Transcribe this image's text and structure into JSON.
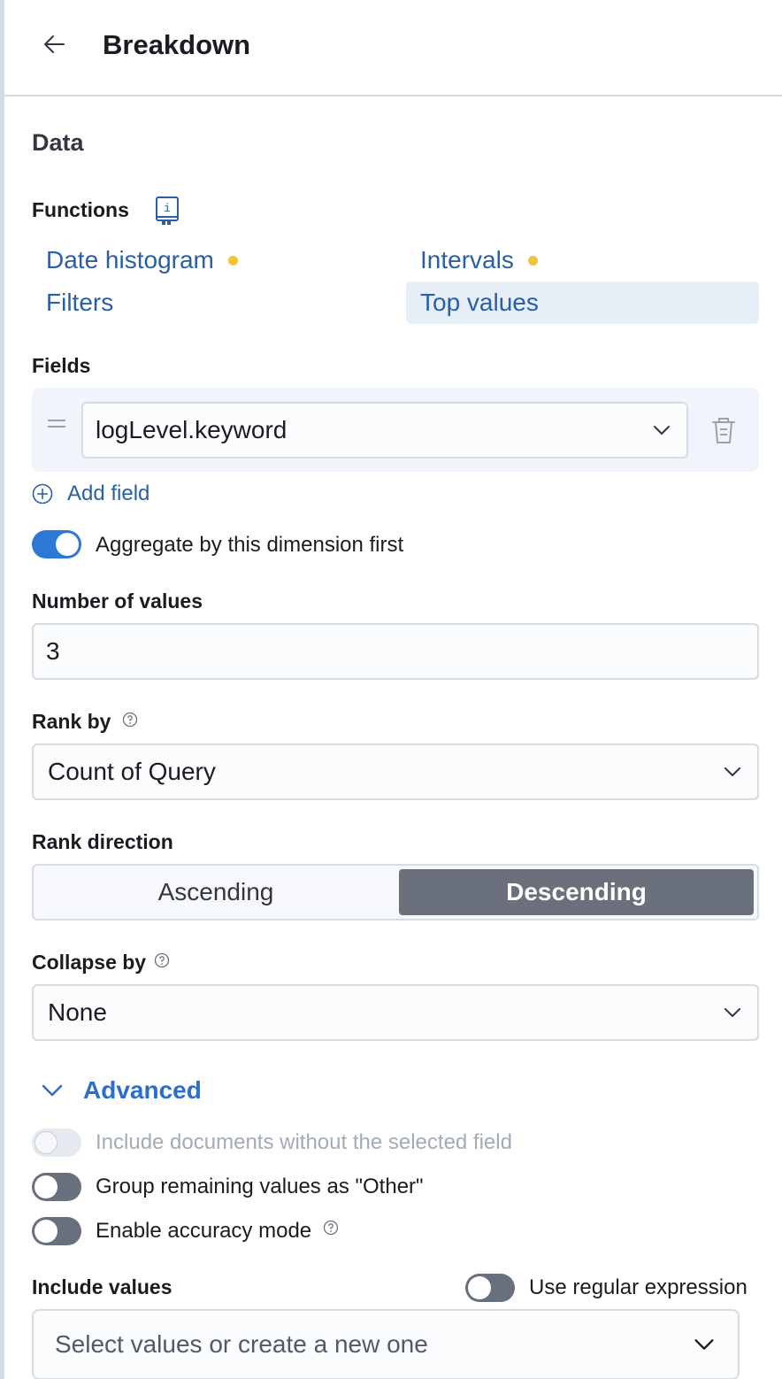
{
  "header": {
    "title": "Breakdown"
  },
  "section": {
    "title": "Data"
  },
  "functions": {
    "label": "Functions",
    "items": [
      {
        "label": "Date histogram",
        "dot": true
      },
      {
        "label": "Intervals",
        "dot": true
      },
      {
        "label": "Filters",
        "dot": false
      },
      {
        "label": "Top values",
        "dot": false,
        "selected": true
      }
    ]
  },
  "fields": {
    "label": "Fields",
    "selected": "logLevel.keyword",
    "add_label": "Add field"
  },
  "aggregate": {
    "label": "Aggregate by this dimension first",
    "on": true
  },
  "number_of_values": {
    "label": "Number of values",
    "value": "3"
  },
  "rank_by": {
    "label": "Rank by",
    "value": "Count of Query"
  },
  "rank_direction": {
    "label": "Rank direction",
    "options": [
      "Ascending",
      "Descending"
    ],
    "selected": "Descending"
  },
  "collapse_by": {
    "label": "Collapse by",
    "value": "None"
  },
  "advanced": {
    "label": "Advanced",
    "include_missing": {
      "label": "Include documents without the selected field",
      "on": false,
      "disabled": true
    },
    "group_other": {
      "label": "Group remaining values as \"Other\"",
      "on": false
    },
    "accuracy": {
      "label": "Enable accuracy mode",
      "on": false
    }
  },
  "include_values": {
    "label": "Include values",
    "regex_label": "Use regular expression",
    "placeholder": "Select values or create a new one"
  },
  "colors": {
    "link": "#2a5fa5",
    "accent": "#2c78d4",
    "dot": "#f0c538",
    "selected_bg": "#e6eef8",
    "desc_bg": "#6a717d"
  }
}
